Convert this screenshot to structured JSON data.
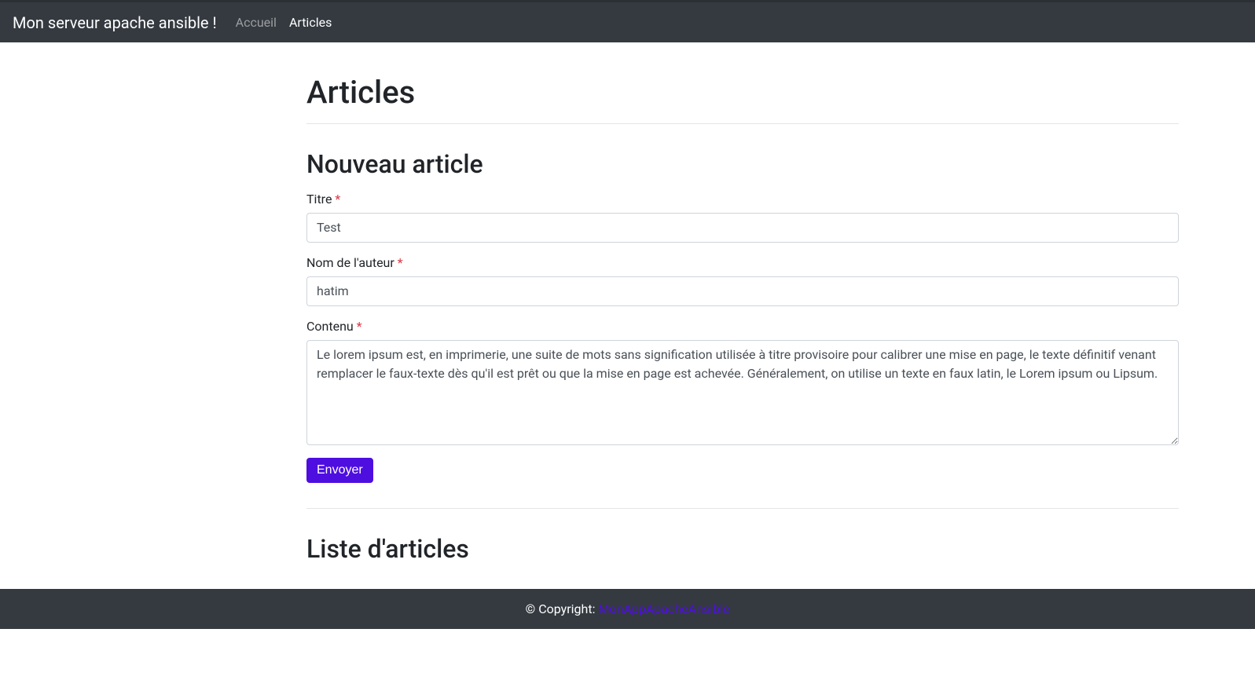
{
  "navbar": {
    "brand": "Mon serveur apache ansible !",
    "links": [
      {
        "label": "Accueil",
        "active": false
      },
      {
        "label": "Articles",
        "active": true
      }
    ]
  },
  "page": {
    "title": "Articles"
  },
  "form": {
    "title": "Nouveau article",
    "fields": {
      "titre": {
        "label": "Titre",
        "value": "Test"
      },
      "auteur": {
        "label": "Nom de l'auteur",
        "value": "hatim"
      },
      "contenu": {
        "label": "Contenu",
        "value": "Le lorem ipsum est, en imprimerie, une suite de mots sans signification utilisée à titre provisoire pour calibrer une mise en page, le texte définitif venant remplacer le faux-texte dès qu'il est prêt ou que la mise en page est achevée. Généralement, on utilise un texte en faux latin, le Lorem ipsum ou Lipsum."
      }
    },
    "submit_label": "Envoyer"
  },
  "list": {
    "title": "Liste d'articles"
  },
  "footer": {
    "copyright": "© Copyright: ",
    "link_label": "MonAppApacheAnsible"
  },
  "required_mark": "*"
}
